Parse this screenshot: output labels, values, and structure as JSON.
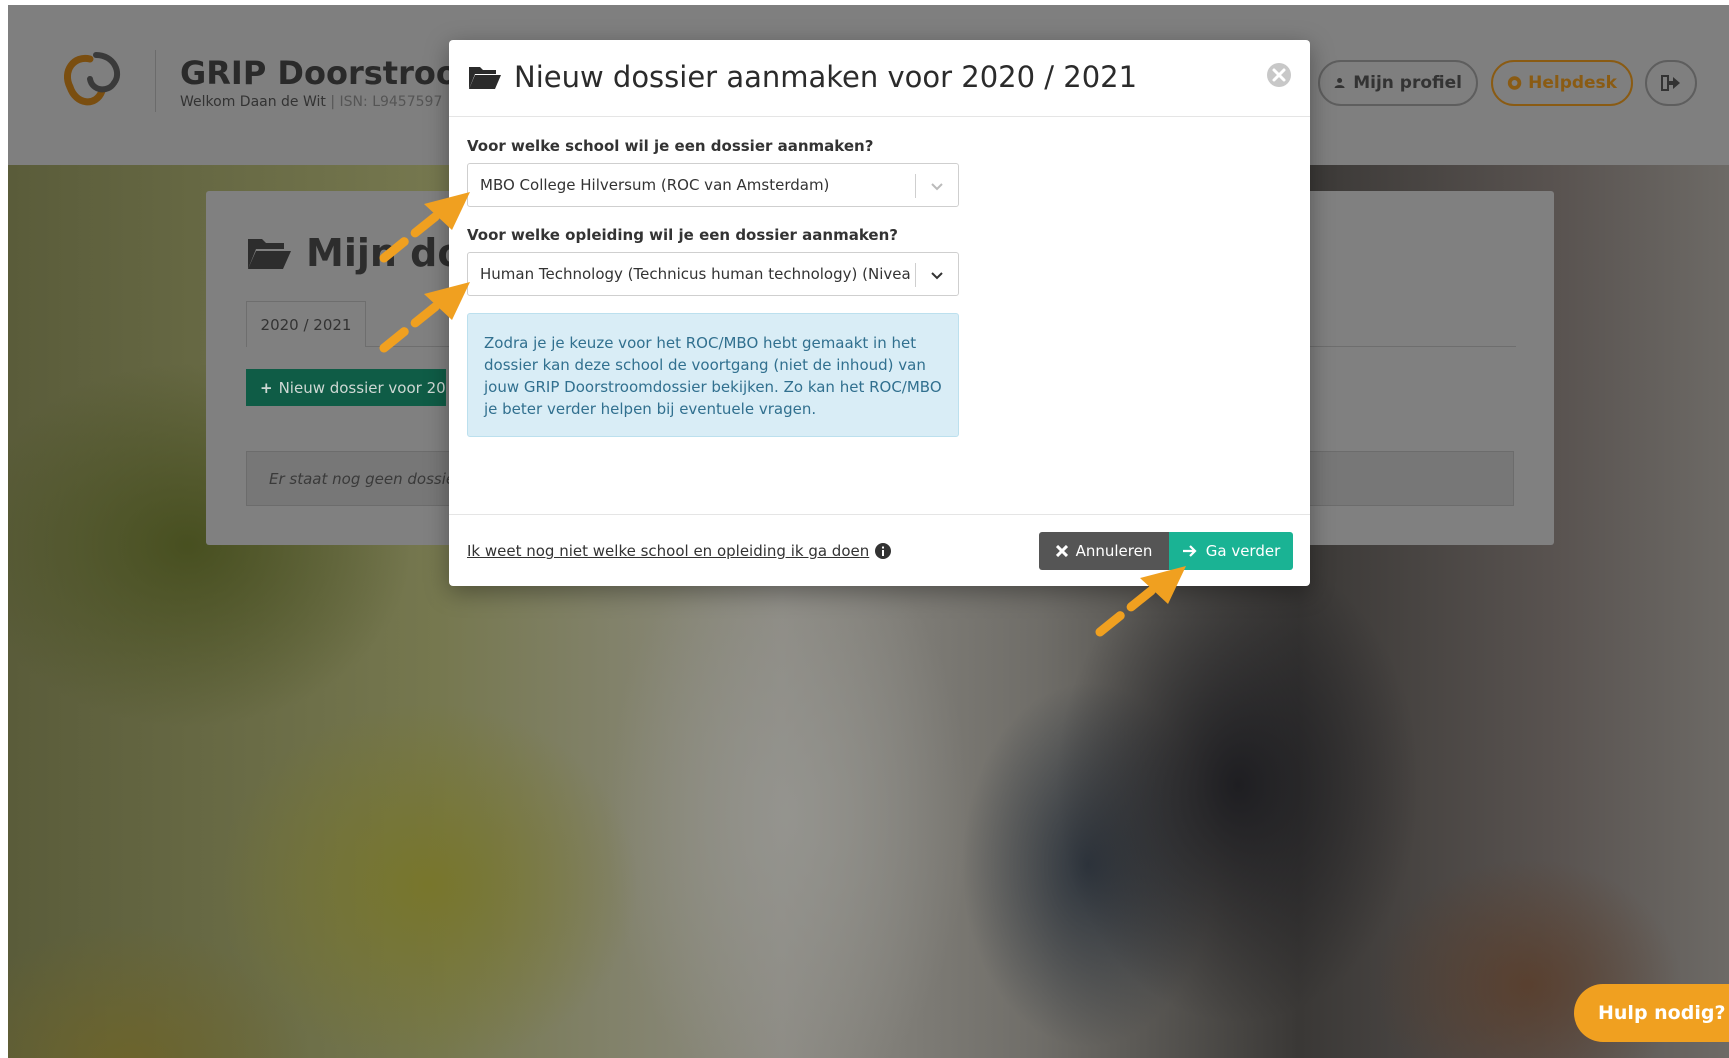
{
  "header": {
    "brand_title": "GRIP Doorstroom",
    "welcome": "Welkom Daan de Wit",
    "isn": "| ISN: L9457597",
    "profile_label": "Mijn profiel",
    "helpdesk_label": "Helpdesk"
  },
  "card": {
    "title": "Mijn do",
    "tab_label": "2020 / 2021",
    "new_button": "Nieuw dossier voor 20",
    "empty_text": "Er staat nog geen dossier"
  },
  "modal": {
    "title": "Nieuw dossier aanmaken voor 2020 / 2021",
    "school_label": "Voor welke school wil je een dossier aanmaken?",
    "school_value": "MBO College Hilversum (ROC van Amsterdam)",
    "program_label": "Voor welke opleiding wil je een dossier aanmaken?",
    "program_value": "Human Technology (Technicus human technology) (Nivea...",
    "info_text": "Zodra je je keuze voor het ROC/MBO hebt gemaakt in het dossier kan deze school de voortgang (niet de inhoud) van jouw GRIP Doorstroomdossier bekijken. Zo kan het ROC/MBO je beter verder helpen bij eventuele vragen.",
    "unknown_link": "Ik weet nog niet welke school en opleiding ik ga doen",
    "cancel_label": "Annuleren",
    "next_label": "Ga verder"
  },
  "help_bubble": "Hulp nodig?",
  "colors": {
    "accent_green": "#1ab394",
    "annotation_arrow": "#f0a020",
    "info_bg": "#d9edf6",
    "info_text": "#31708f"
  }
}
